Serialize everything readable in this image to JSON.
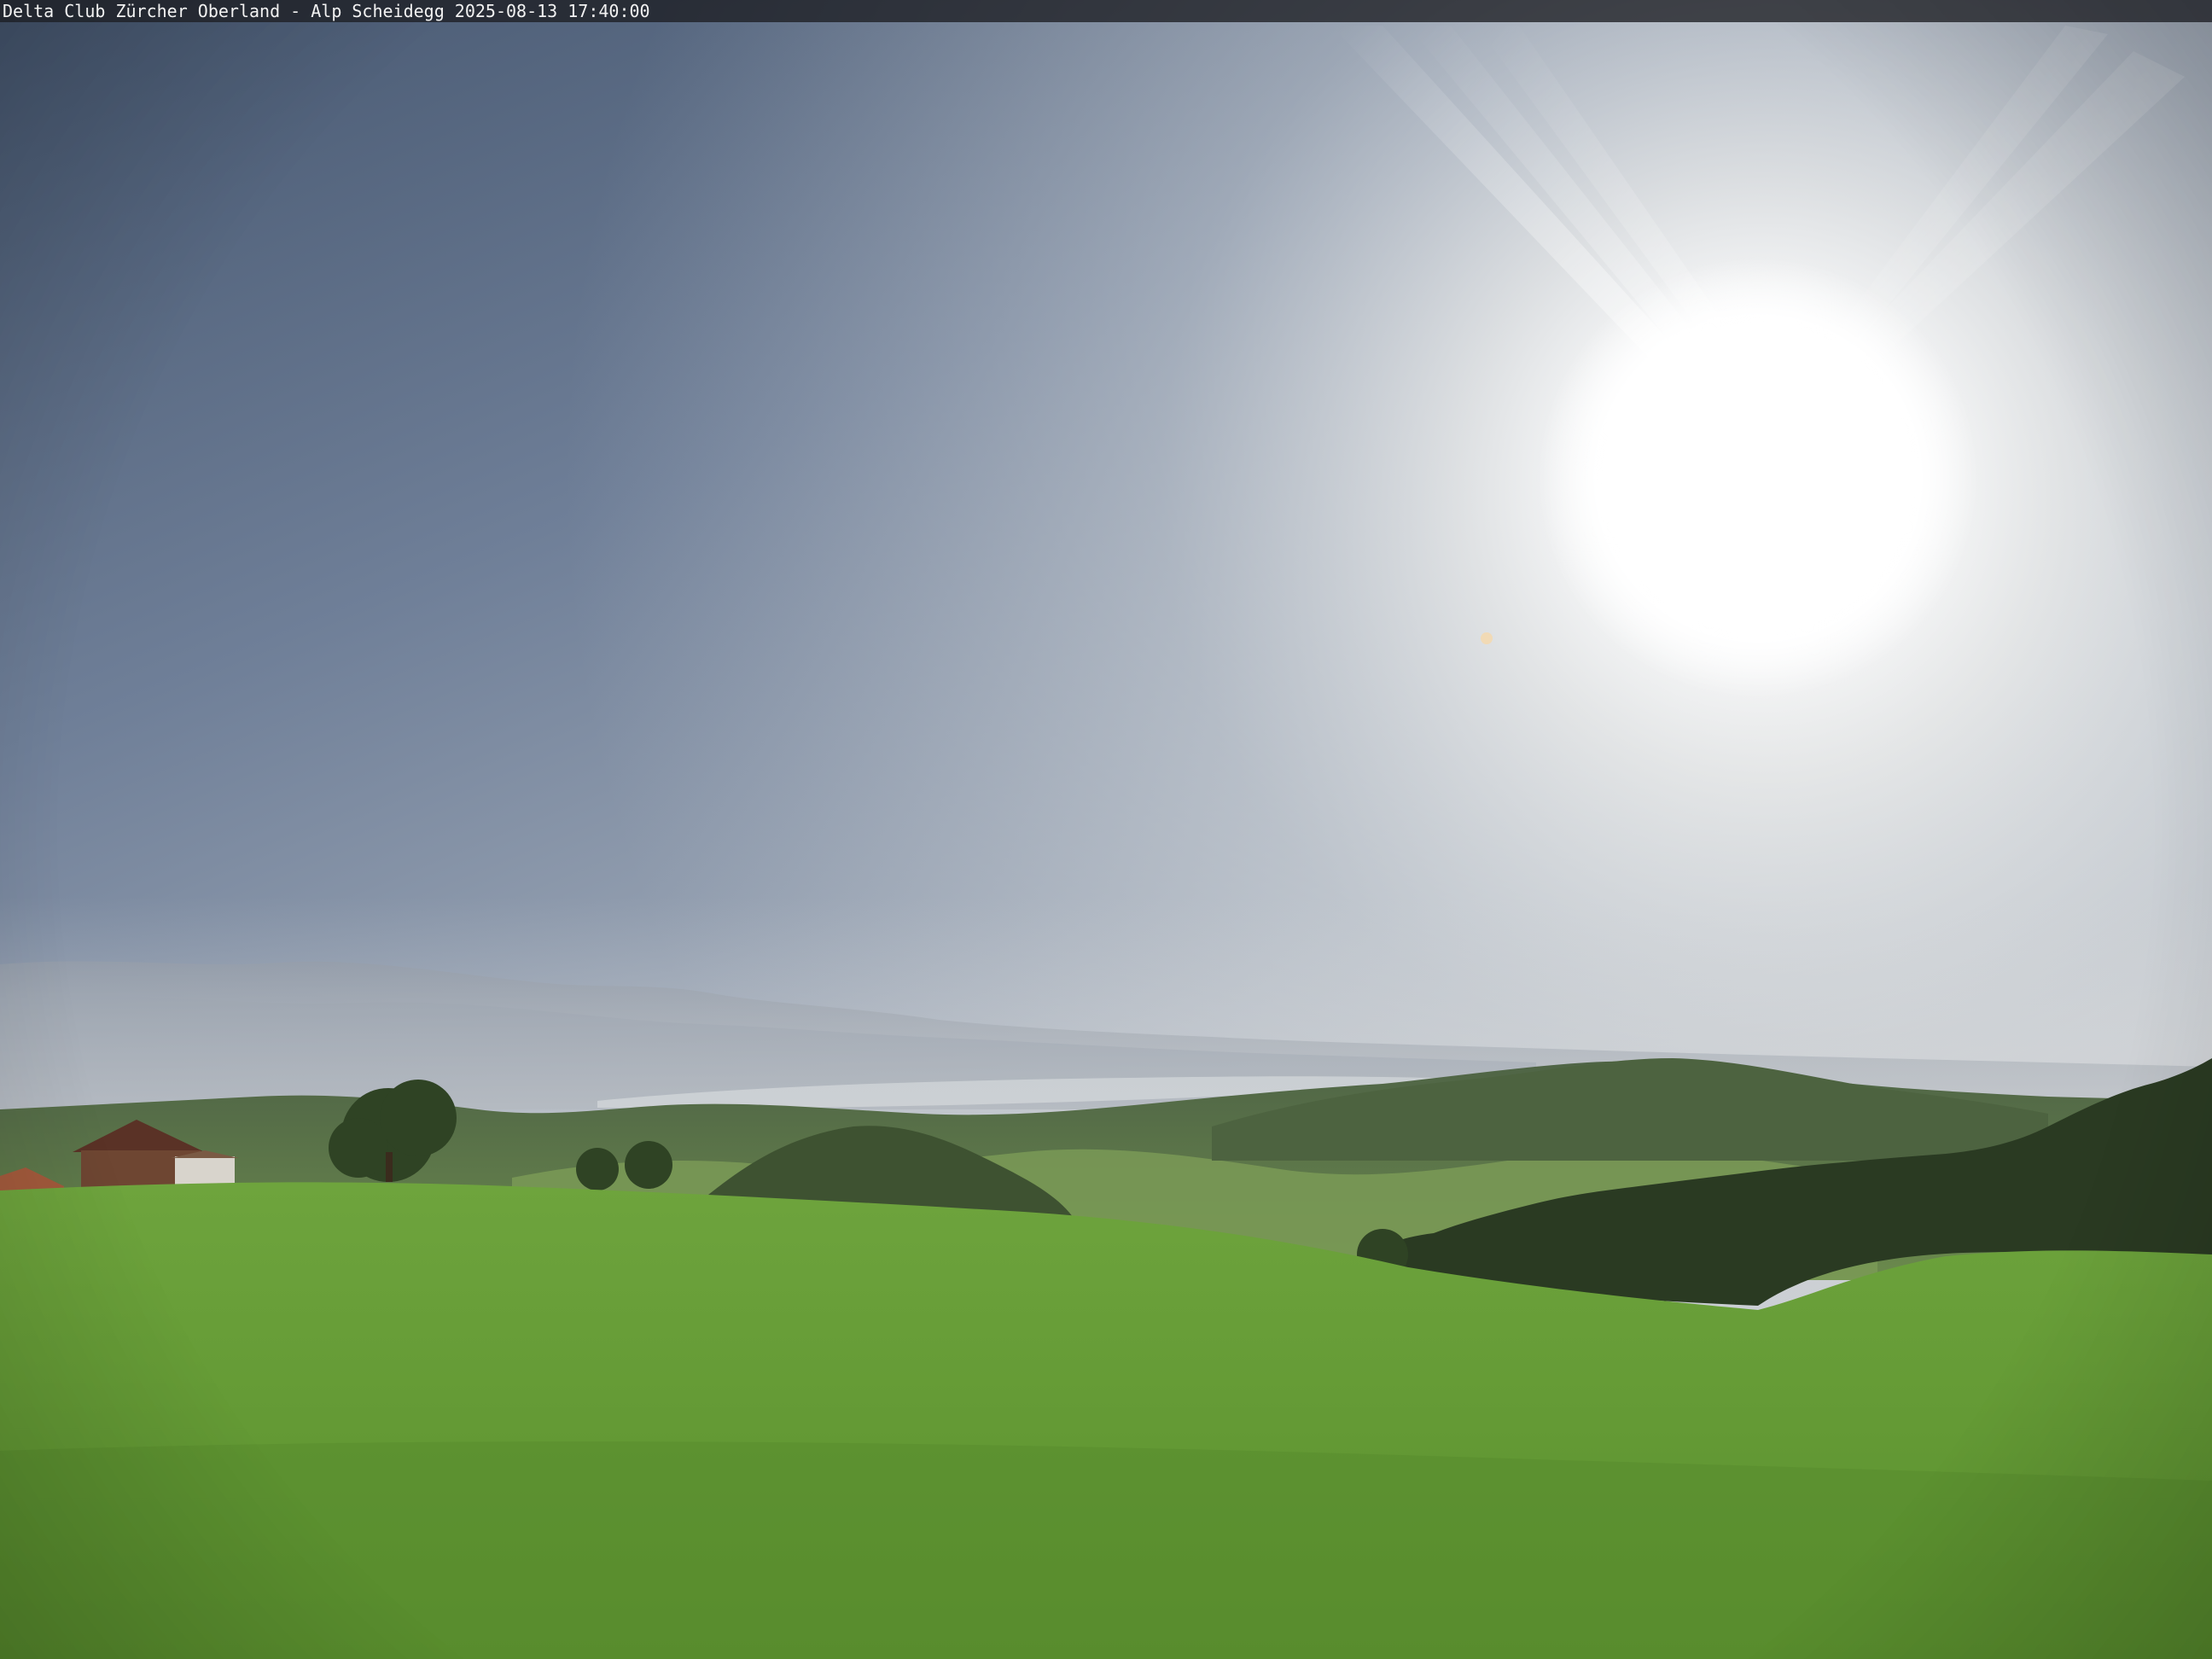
{
  "caption": {
    "text": "Delta Club Zürcher Oberland - Alp Scheidegg 2025-08-13 17:40:00"
  },
  "colors": {
    "sky_top_left": "#4b5c79",
    "sky_horizon": "#c9ccd1",
    "sun_core": "#ffffff",
    "distant_mountains": "#9aa3ad",
    "lake": "#c6ccd2",
    "mid_hills": "#5f7a52",
    "forest": "#2c3d24",
    "meadow": "#6aa03a",
    "farmhouse_roof": "#5a3226",
    "caption_bar": "#1c1e22",
    "caption_text": "#f2f2f2"
  }
}
